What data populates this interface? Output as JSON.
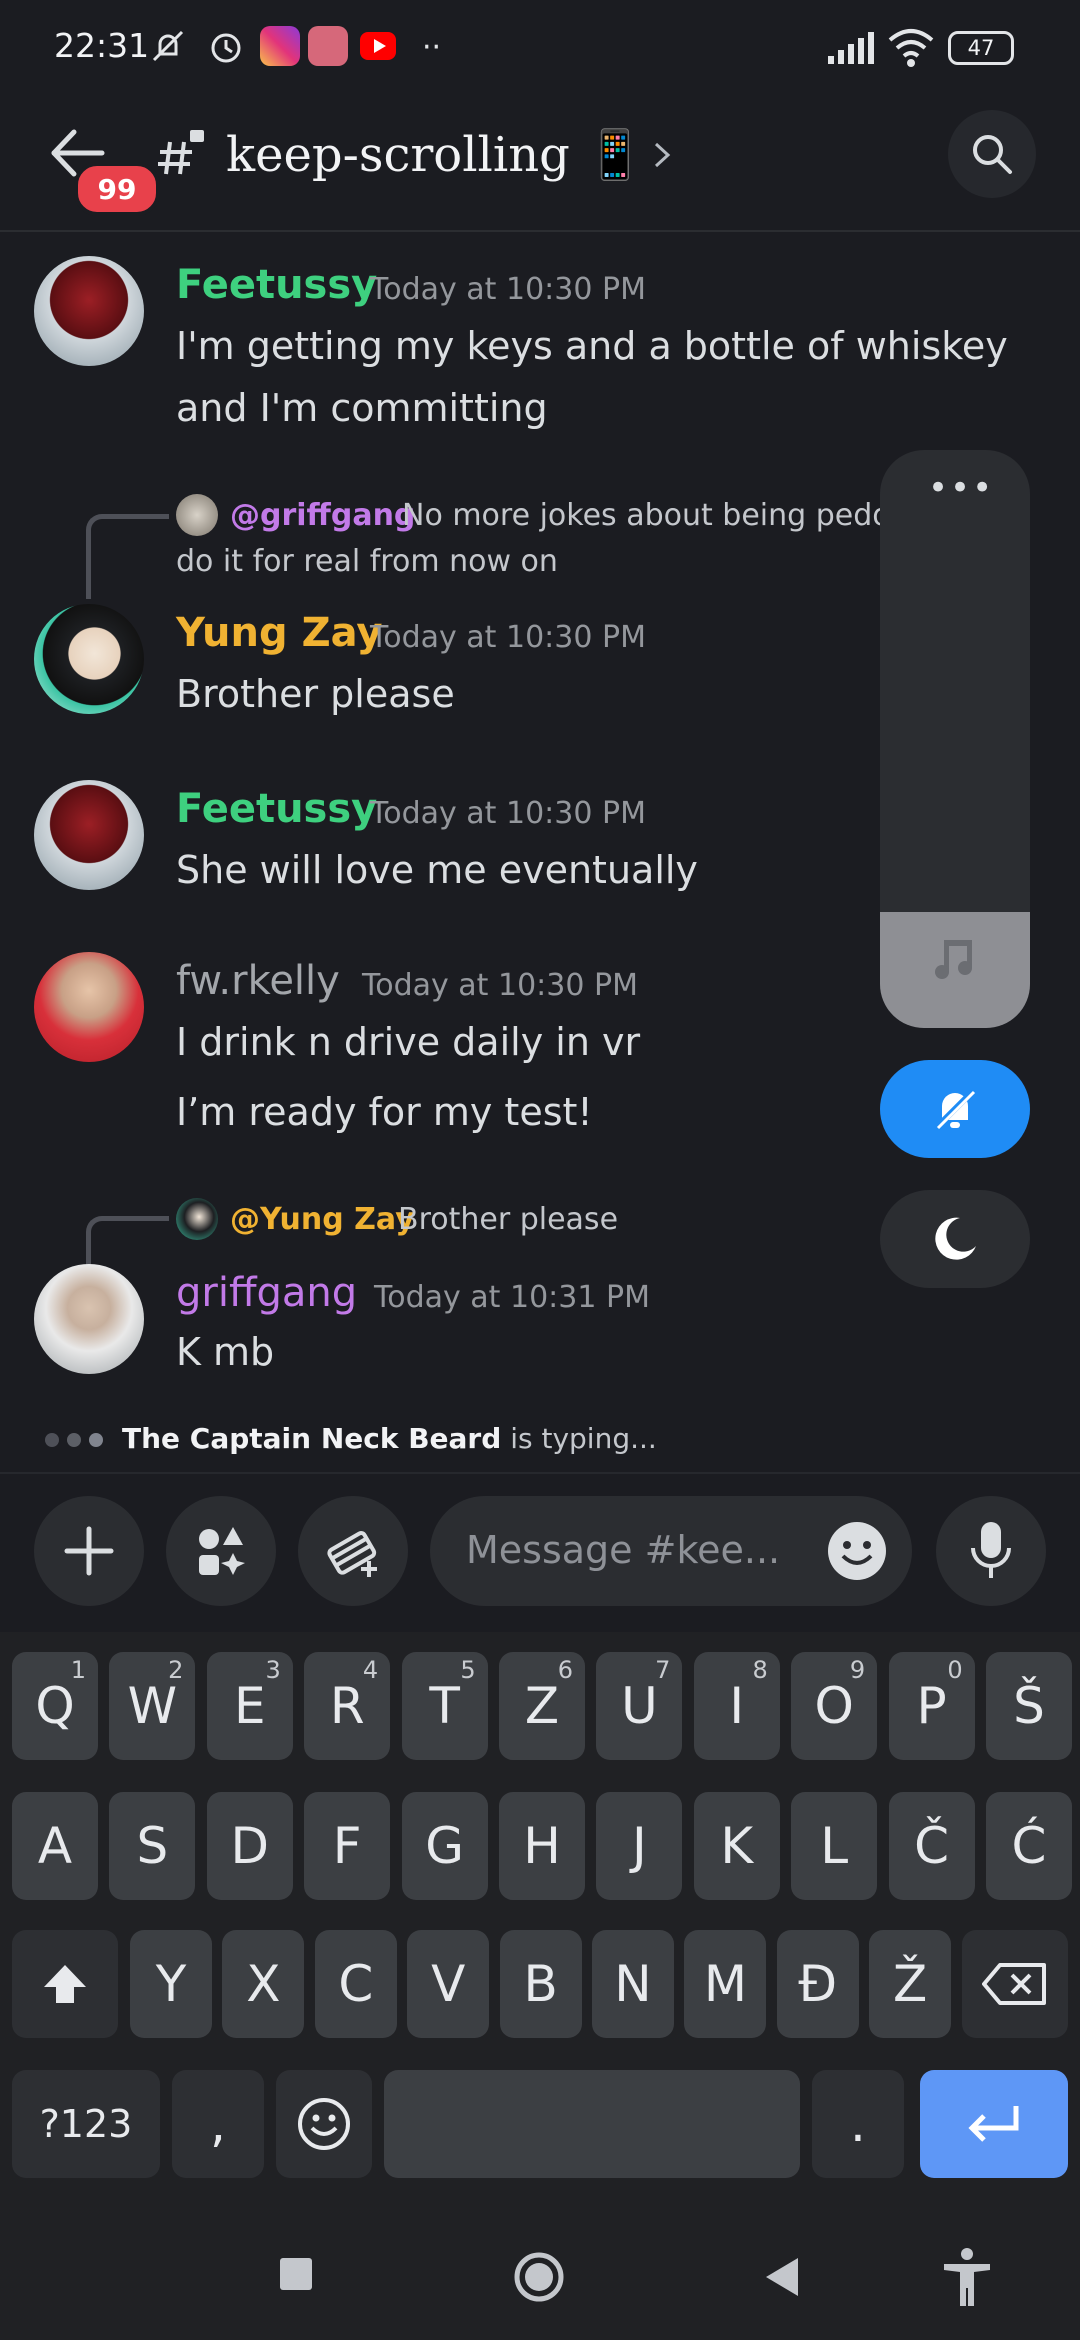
{
  "status": {
    "time": "22:31",
    "battery": "47"
  },
  "header": {
    "unread_badge": "99",
    "channel": "keep-scrolling 📱"
  },
  "messages": [
    {
      "user": "Feetussy",
      "color": "#3ed07f",
      "time": "Today at 10:30 PM",
      "lines": [
        "I'm getting my keys and a bottle of whiskey",
        "and I'm committing"
      ]
    },
    {
      "reply_user": "@griffgang",
      "reply_color": "#c27ae8",
      "reply_text": "No more jokes about being pedos",
      "reply_text2": "do it for real from now on",
      "user": "Yung Zay",
      "color": "#f0b232",
      "time": "Today at 10:30 PM",
      "lines": [
        "Brother please"
      ]
    },
    {
      "user": "Feetussy",
      "color": "#3ed07f",
      "time": "Today at 10:30 PM",
      "lines": [
        "She will love me eventually"
      ]
    },
    {
      "user": "fw.rkelly",
      "color": "#a3a6ab",
      "time": "Today at 10:30 PM",
      "lines": [
        "I drink n drive daily in vr",
        "I’m ready for my test!"
      ]
    },
    {
      "reply_user": "@Yung Zay",
      "reply_color": "#f0b232",
      "reply_text": "Brother please",
      "user": "griffgang",
      "color": "#c27ae8",
      "time": "Today at 10:31 PM",
      "lines": [
        "K mb"
      ]
    }
  ],
  "typing": {
    "name": "The Captain Neck Beard",
    "suffix": " is typing..."
  },
  "composer": {
    "placeholder": "Message #kee..."
  },
  "volume_level": 0.2,
  "keyboard": {
    "row1": [
      [
        "Q",
        "1"
      ],
      [
        "W",
        "2"
      ],
      [
        "E",
        "3"
      ],
      [
        "R",
        "4"
      ],
      [
        "T",
        "5"
      ],
      [
        "Z",
        "6"
      ],
      [
        "U",
        "7"
      ],
      [
        "I",
        "8"
      ],
      [
        "O",
        "9"
      ],
      [
        "P",
        "0"
      ],
      [
        "Š",
        ""
      ]
    ],
    "row2": [
      "A",
      "S",
      "D",
      "F",
      "G",
      "H",
      "J",
      "K",
      "L",
      "Č",
      "Ć"
    ],
    "row3": [
      "Y",
      "X",
      "C",
      "V",
      "B",
      "N",
      "M",
      "Đ",
      "Ž"
    ],
    "row4": {
      "sym": "?123",
      "comma": ",",
      "period": "."
    }
  },
  "colors": {
    "accent_blue": "#1f8cf5",
    "enter_blue": "#5e97f6",
    "badge_red": "#e8414b"
  }
}
